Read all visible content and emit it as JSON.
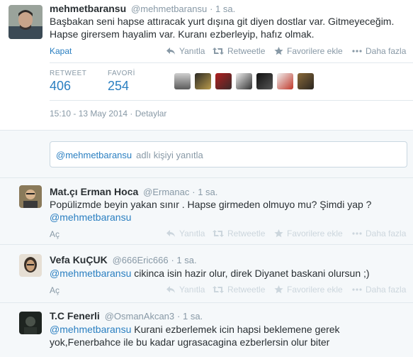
{
  "main": {
    "name": "mehmetbaransu",
    "handle": "@mehmetbaransu",
    "time": "· 1 sa.",
    "text_line1": "Başbakan seni hapse attıracak yurt dışına git diyen dostlar var. Gitmeyeceğim.",
    "text_line2": "Hapse girersem hayalim var. Kuranı ezberleyip, hafız olmak.",
    "collapse_label": "Kapat",
    "actions": {
      "reply": "Yanıtla",
      "retweet": "Retweetle",
      "favorite": "Favorilere ekle",
      "more": "Daha fazla"
    },
    "stats": {
      "retweet_label": "RETWEET",
      "retweet_count": "406",
      "favorite_label": "FAVORİ",
      "favorite_count": "254"
    },
    "datetime": "15:10 - 13 May 2014 · Detaylar"
  },
  "reply_box": {
    "mention": "@mehmetbaransu",
    "placeholder": "adlı kişiyi yanıtla"
  },
  "replies": [
    {
      "name": "Mat.çı Erman Hoca",
      "handle": "@Ermanac",
      "time": "· 1 sa.",
      "text": "Popülizmde beyin yakan sınır . Hapse girmeden olmuyo mu? Şimdi yap ?",
      "mention": "@mehmetbaransu",
      "open_label": "Aç"
    },
    {
      "name": "Vefa KuÇUK",
      "handle": "@666Eric666",
      "time": "· 1 sa.",
      "mention": "@mehmetbaransu",
      "text": " cikinca isin hazir olur, direk Diyanet baskani olursun ;)",
      "open_label": "Aç"
    },
    {
      "name": "T.C Fenerli",
      "handle": "@OsmanAkcan3",
      "time": "· 1 sa.",
      "mention": "@mehmetbaransu",
      "text_line1": " Kurani ezberlemek icin hapsi beklemene gerek",
      "text_line2": "yok,Fenerbahce ile bu kadar ugrasacagina ezberlersin olur biter"
    }
  ],
  "colors": {
    "link": "#2a7fc1",
    "muted": "#8899a6",
    "reply_bg": "#f5f8fa"
  }
}
